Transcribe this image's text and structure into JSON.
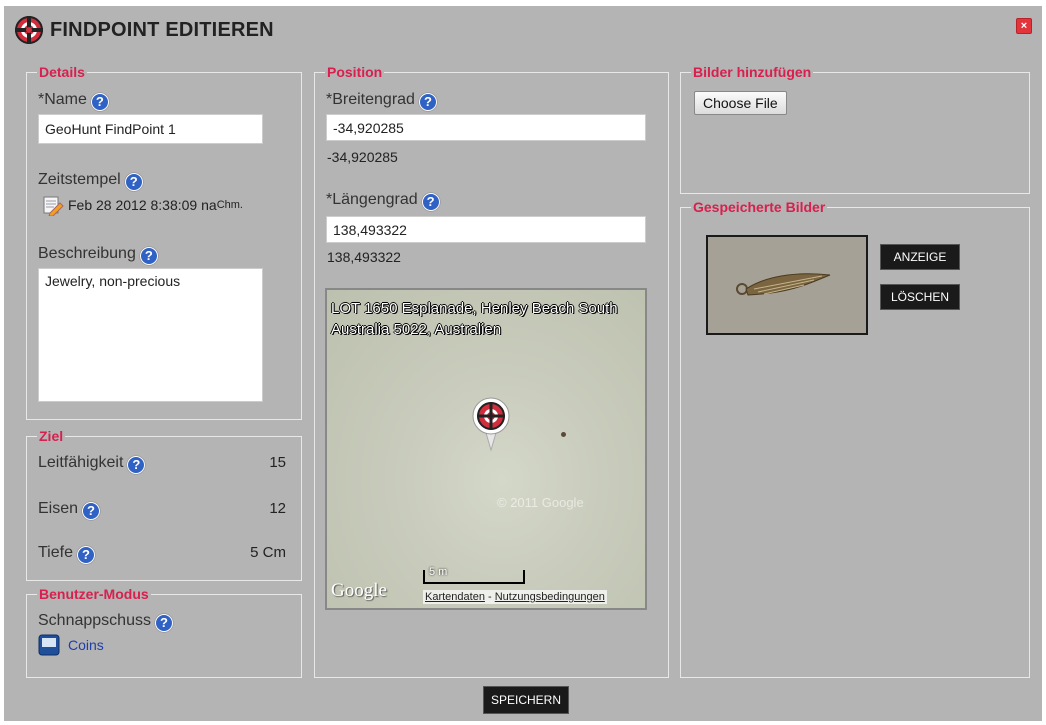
{
  "dialog": {
    "title": "FINDPOINT EDITIEREN"
  },
  "details": {
    "legend": "Details",
    "name_label": "*Name",
    "name_value": "GeoHunt FindPoint 1",
    "timestamp_label": "Zeitstempel",
    "timestamp_value": "Feb 28 2012 8:38:09 na",
    "timestamp_suffix": "Chm.",
    "description_label": "Beschreibung",
    "description_value": "Jewelry, non-precious"
  },
  "ziel": {
    "legend": "Ziel",
    "rows": [
      {
        "label": "Leitfähigkeit",
        "value": "15"
      },
      {
        "label": "Eisen",
        "value": "12"
      },
      {
        "label": "Tiefe",
        "value": "5 Cm"
      }
    ]
  },
  "benutzer": {
    "legend": "Benutzer-Modus",
    "snapshot_label": "Schnappschuss",
    "snapshot_value": "Coins"
  },
  "position": {
    "legend": "Position",
    "lat_label": "*Breitengrad",
    "lat_value": "-34,920285",
    "lat_display": "-34,920285",
    "lng_label": "*Längengrad",
    "lng_value": "138,493322",
    "lng_display": "138,493322",
    "map": {
      "address": "LOT 1650 Esplanade, Henley Beach South Australia 5022, Australien",
      "logo": "Google",
      "scale": "5 m",
      "watermark": "© 2011 Google",
      "map_data_link": "Kartendaten",
      "separator": " - ",
      "terms_link": "Nutzungsbedingungen"
    }
  },
  "images_add": {
    "legend": "Bilder hinzufügen",
    "choose_file": "Choose File"
  },
  "images_saved": {
    "legend": "Gespeicherte Bilder",
    "show_button": "ANZEIGE",
    "delete_button": "LÖSCHEN"
  },
  "footer": {
    "save_button": "SPEICHERN"
  },
  "colors": {
    "dialog_bg": "#b4b4b4",
    "legend": "#d81f4d",
    "help_icon": "#2f62c4",
    "close": "#e2353b"
  },
  "icons": [
    "target-logo-icon",
    "close-icon",
    "help-icon",
    "notepad-pencil-icon",
    "snapshot-icon",
    "map-marker-icon"
  ]
}
